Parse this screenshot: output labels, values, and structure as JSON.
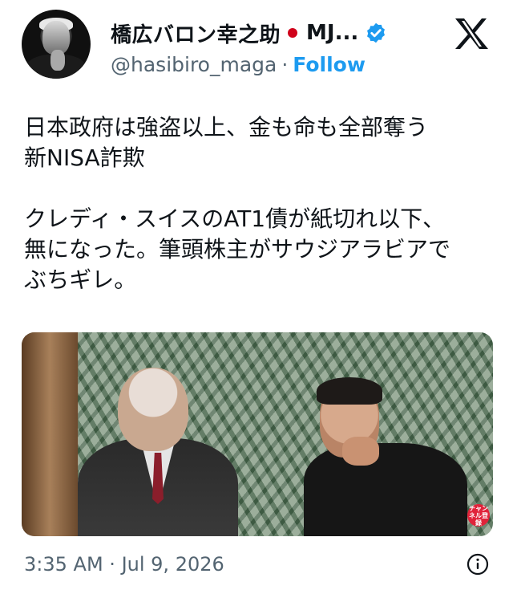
{
  "author": {
    "display_name": "橋広バロン幸之助",
    "flag_icon": "japan-flag-icon",
    "name_suffix": "MJ...",
    "handle": "@hasibiro_maga",
    "separator": "·",
    "follow_label": "Follow",
    "verified": true
  },
  "tweet": {
    "text": "日本政府は強盗以上、金も命も全部奪う\n新NISA詐欺\n\nクレディ・スイスのAT1債が紙切れ以下、\n無になった。筆頭株主がサウジアラビアで\nぶちギレ。"
  },
  "media": {
    "badge_text": "チャンネル登録"
  },
  "meta": {
    "time": "3:35 AM",
    "separator": "·",
    "date": "Jul 9, 2026"
  },
  "colors": {
    "text": "#0f1419",
    "secondary": "#536471",
    "accent": "#1d9bf0",
    "verified_badge": "#1d9bf0"
  }
}
